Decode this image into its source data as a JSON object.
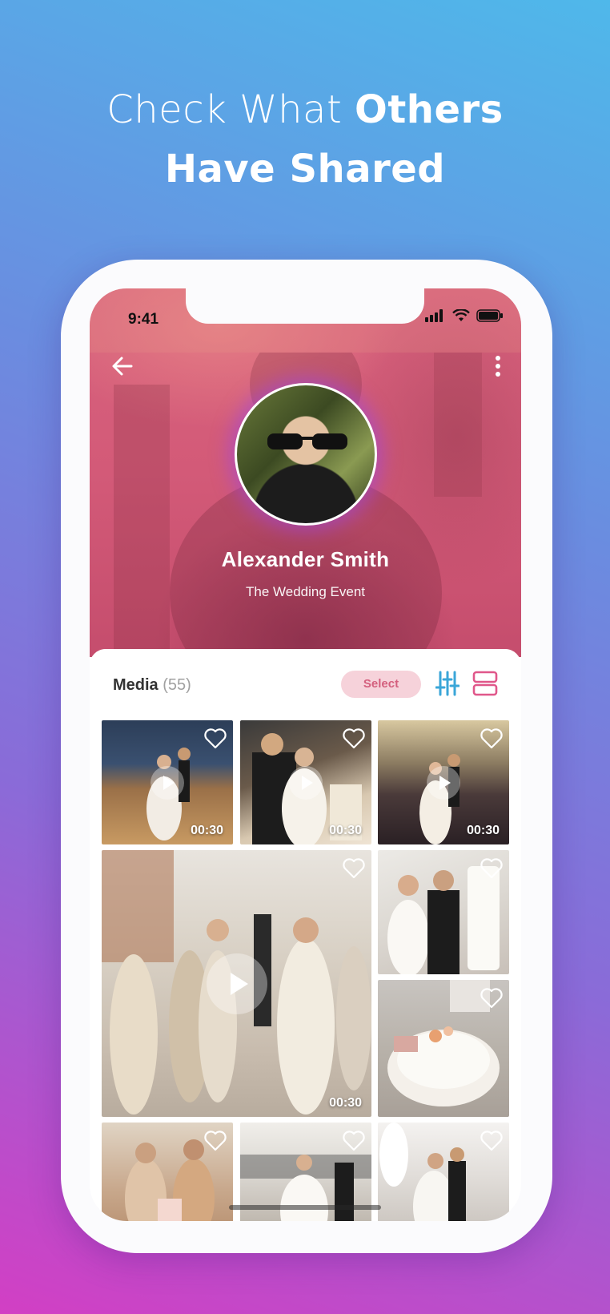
{
  "headline": {
    "line1_light": "Check What ",
    "line1_bold": "Others",
    "line2_bold": "Have Shared"
  },
  "status_bar": {
    "time": "9:41",
    "icons": [
      "signal-icon",
      "wifi-icon",
      "battery-icon"
    ]
  },
  "header": {
    "back_icon": "arrow-left-icon",
    "more_icon": "more-vertical-icon"
  },
  "profile": {
    "name": "Alexander Smith",
    "event": "The Wedding Event"
  },
  "media": {
    "label": "Media",
    "count": "(55)",
    "select_label": "Select",
    "filter_icon": "sliders-icon",
    "layout_icon": "grid-toggle-icon",
    "items": [
      {
        "type": "video",
        "duration": "00:30",
        "scene": "dancing couple on wooden floor"
      },
      {
        "type": "video",
        "duration": "00:30",
        "scene": "couple cutting cake"
      },
      {
        "type": "video",
        "duration": "00:30",
        "scene": "couple dancing in tent"
      },
      {
        "type": "video",
        "duration": "00:30",
        "scene": "guests dancing"
      },
      {
        "type": "photo",
        "scene": "couple cutting white cake"
      },
      {
        "type": "photo",
        "scene": "wedding cake close-up"
      },
      {
        "type": "photo",
        "scene": "couple with guests and cake"
      },
      {
        "type": "photo",
        "scene": "bride walking with guests"
      },
      {
        "type": "photo",
        "scene": "couple dancing with sparklers"
      }
    ]
  },
  "colors": {
    "accent_pink": "#d4607e",
    "accent_blue": "#3aa6d8",
    "hero_pink": "#d35a78"
  }
}
